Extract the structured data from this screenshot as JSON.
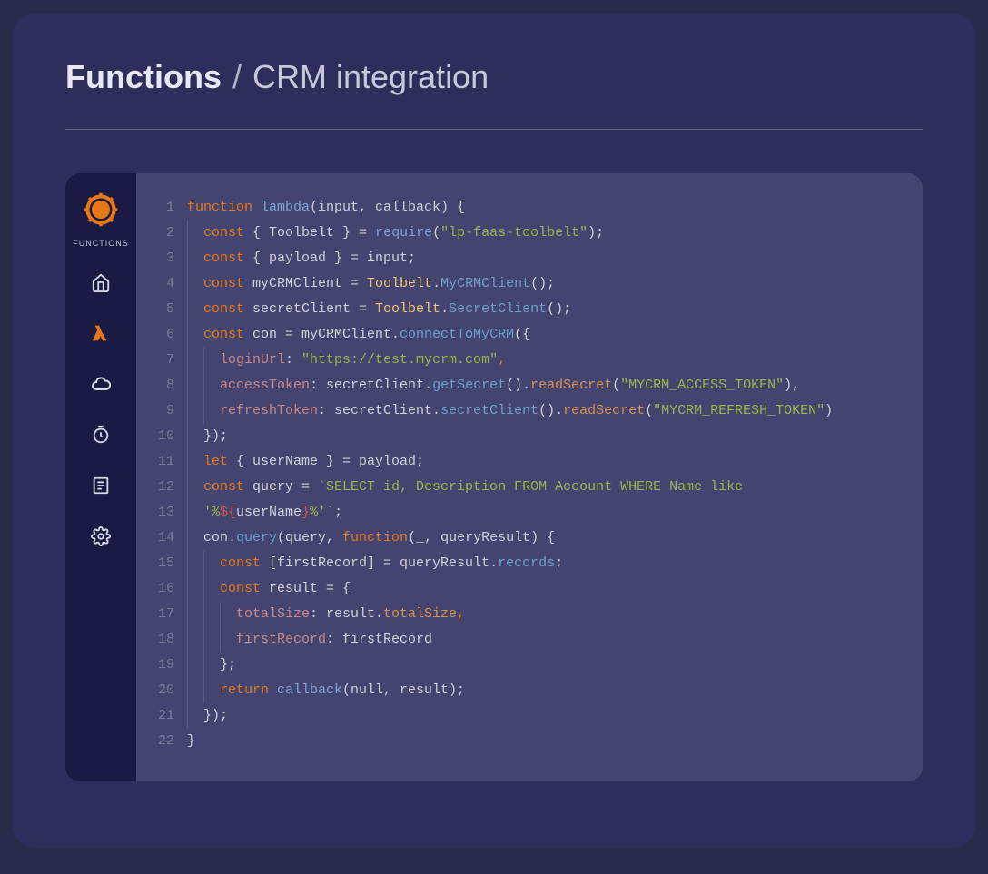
{
  "breadcrumb": {
    "title": "Functions",
    "separator": "/",
    "page": "CRM integration"
  },
  "sidebar": {
    "logo_label": "FUNCTIONS",
    "items": [
      {
        "name": "home"
      },
      {
        "name": "lambda",
        "active": true
      },
      {
        "name": "cloud"
      },
      {
        "name": "schedule"
      },
      {
        "name": "logs"
      },
      {
        "name": "settings"
      }
    ]
  },
  "code": {
    "line_count": 22,
    "lines": [
      [
        {
          "t": "function ",
          "c": "kw"
        },
        {
          "t": "lambda",
          "c": "fn"
        },
        {
          "t": "(input, callback) {",
          "c": "plain"
        }
      ],
      [
        {
          "t": "const",
          "c": "kw"
        },
        {
          "t": " { ",
          "c": "op"
        },
        {
          "t": "Toolbelt",
          "c": "plain"
        },
        {
          "t": " } = ",
          "c": "op"
        },
        {
          "t": "require",
          "c": "fn"
        },
        {
          "t": "(",
          "c": "op"
        },
        {
          "t": "\"lp-faas-toolbelt\"",
          "c": "str"
        },
        {
          "t": ");",
          "c": "op"
        }
      ],
      [
        {
          "t": "const",
          "c": "kw"
        },
        {
          "t": " { ",
          "c": "op"
        },
        {
          "t": "payload",
          "c": "plain"
        },
        {
          "t": " } = input;",
          "c": "plain"
        }
      ],
      [
        {
          "t": "const",
          "c": "kw"
        },
        {
          "t": " myCRMClient = ",
          "c": "plain"
        },
        {
          "t": "Toolbelt",
          "c": "def"
        },
        {
          "t": ".",
          "c": "op"
        },
        {
          "t": "MyCRMClient",
          "c": "method"
        },
        {
          "t": "();",
          "c": "op"
        }
      ],
      [
        {
          "t": "const",
          "c": "kw"
        },
        {
          "t": " secretClient = ",
          "c": "plain"
        },
        {
          "t": "Toolbelt",
          "c": "def"
        },
        {
          "t": ".",
          "c": "op"
        },
        {
          "t": "SecretClient",
          "c": "method"
        },
        {
          "t": "();",
          "c": "op"
        }
      ],
      [
        {
          "t": "const",
          "c": "kw"
        },
        {
          "t": " con = myCRMClient.",
          "c": "plain"
        },
        {
          "t": "connectToMyCRM",
          "c": "method"
        },
        {
          "t": "({",
          "c": "op"
        }
      ],
      [
        {
          "t": "loginUrl",
          "c": "prop"
        },
        {
          "t": ": ",
          "c": "op"
        },
        {
          "t": "\"https://test.mycrm.com\"",
          "c": "str"
        },
        {
          "t": ",",
          "c": "kw"
        }
      ],
      [
        {
          "t": "accessToken",
          "c": "prop"
        },
        {
          "t": ": secretClient.",
          "c": "plain"
        },
        {
          "t": "getSecret",
          "c": "method"
        },
        {
          "t": "().",
          "c": "op"
        },
        {
          "t": "readSecret",
          "c": "meth-orange"
        },
        {
          "t": "(",
          "c": "op"
        },
        {
          "t": "\"MYCRM_ACCESS_TOKEN\"",
          "c": "str"
        },
        {
          "t": "),",
          "c": "op"
        }
      ],
      [
        {
          "t": "refreshToken",
          "c": "prop"
        },
        {
          "t": ": secretClient.",
          "c": "plain"
        },
        {
          "t": "secretClient",
          "c": "method"
        },
        {
          "t": "().",
          "c": "op"
        },
        {
          "t": "readSecret",
          "c": "meth-orange"
        },
        {
          "t": "(",
          "c": "op"
        },
        {
          "t": "\"MYCRM_REFRESH_TOKEN\"",
          "c": "str"
        },
        {
          "t": ")",
          "c": "op"
        }
      ],
      [
        {
          "t": "});",
          "c": "op"
        }
      ],
      [
        {
          "t": "let",
          "c": "kw"
        },
        {
          "t": " { userName } = payload;",
          "c": "plain"
        }
      ],
      [
        {
          "t": "const",
          "c": "kw"
        },
        {
          "t": " query = ",
          "c": "plain"
        },
        {
          "t": "`SELECT id, Description FROM Account WHERE Name like ",
          "c": "tpl"
        }
      ],
      [
        {
          "t": "'%",
          "c": "tpl"
        },
        {
          "t": "${",
          "c": "red"
        },
        {
          "t": "userName",
          "c": "plain"
        },
        {
          "t": "}",
          "c": "red"
        },
        {
          "t": "%'`",
          "c": "tpl"
        },
        {
          "t": ";",
          "c": "op"
        }
      ],
      [
        {
          "t": "con.",
          "c": "plain"
        },
        {
          "t": "query",
          "c": "method"
        },
        {
          "t": "(query, ",
          "c": "plain"
        },
        {
          "t": "function",
          "c": "kw"
        },
        {
          "t": "(_, queryResult) {",
          "c": "plain"
        }
      ],
      [
        {
          "t": "const",
          "c": "kw"
        },
        {
          "t": " [firstRecord] = queryResult.",
          "c": "plain"
        },
        {
          "t": "records",
          "c": "method"
        },
        {
          "t": ";",
          "c": "op"
        }
      ],
      [
        {
          "t": "const",
          "c": "kw"
        },
        {
          "t": " result = {",
          "c": "plain"
        }
      ],
      [
        {
          "t": "totalSize",
          "c": "prop"
        },
        {
          "t": ": result.",
          "c": "plain"
        },
        {
          "t": "totalSize",
          "c": "meth-orange"
        },
        {
          "t": ",",
          "c": "kw"
        }
      ],
      [
        {
          "t": "firstRecord",
          "c": "prop"
        },
        {
          "t": ": firstRecord",
          "c": "plain"
        }
      ],
      [
        {
          "t": "};",
          "c": "op"
        }
      ],
      [
        {
          "t": "return ",
          "c": "kw"
        },
        {
          "t": "callback",
          "c": "fn"
        },
        {
          "t": "(null, result);",
          "c": "plain"
        }
      ],
      [
        {
          "t": "});",
          "c": "op"
        }
      ],
      [
        {
          "t": "}",
          "c": "op"
        }
      ]
    ],
    "indents": [
      0,
      1,
      1,
      1,
      1,
      1,
      2,
      2,
      2,
      1,
      1,
      1,
      1,
      1,
      2,
      2,
      3,
      3,
      2,
      2,
      1,
      0
    ]
  }
}
